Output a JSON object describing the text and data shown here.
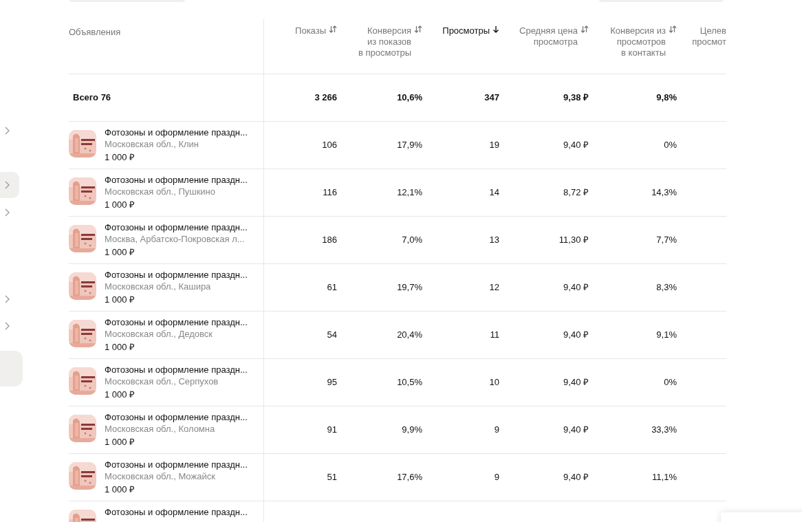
{
  "table": {
    "columns": [
      {
        "label": "Объявления"
      },
      {
        "label": "Показы",
        "selected": false
      },
      {
        "label": "Конверсия\nиз показов\nв просмотры",
        "selected": false
      },
      {
        "label": "Просмотры",
        "selected": true
      },
      {
        "label": "Средняя цена\nпросмотра",
        "selected": false
      },
      {
        "label": "Конверсия из\nпросмотров\nв контакты",
        "selected": false
      },
      {
        "label": "Целев\nпросмот"
      }
    ],
    "total": {
      "label": "Всего 76",
      "values": [
        "3 266",
        "10,6%",
        "347",
        "9,38 ₽",
        "9,8%"
      ]
    },
    "rows": [
      {
        "title": "Фотозоны и оформление праздн...",
        "location": "Московская обл., Клин",
        "price": "1 000 ₽",
        "values": [
          "106",
          "17,9%",
          "19",
          "9,40 ₽",
          "0%"
        ]
      },
      {
        "title": "Фотозоны и оформление праздн...",
        "location": "Московская обл., Пушкино",
        "price": "1 000 ₽",
        "values": [
          "116",
          "12,1%",
          "14",
          "8,72 ₽",
          "14,3%"
        ]
      },
      {
        "title": "Фотозоны и оформление праздн...",
        "location": "Москва, Арбатско-Покровская л...",
        "price": "1 000 ₽",
        "values": [
          "186",
          "7,0%",
          "13",
          "11,30 ₽",
          "7,7%"
        ]
      },
      {
        "title": "Фотозоны и оформление праздн...",
        "location": "Московская обл., Кашира",
        "price": "1 000 ₽",
        "values": [
          "61",
          "19,7%",
          "12",
          "9,40 ₽",
          "8,3%"
        ]
      },
      {
        "title": "Фотозоны и оформление праздн...",
        "location": "Московская обл., Дедовск",
        "price": "1 000 ₽",
        "values": [
          "54",
          "20,4%",
          "11",
          "9,40 ₽",
          "9,1%"
        ]
      },
      {
        "title": "Фотозоны и оформление праздн...",
        "location": "Московская обл., Серпухов",
        "price": "1 000 ₽",
        "values": [
          "95",
          "10,5%",
          "10",
          "9,40 ₽",
          "0%"
        ]
      },
      {
        "title": "Фотозоны и оформление праздн...",
        "location": "Московская обл., Коломна",
        "price": "1 000 ₽",
        "values": [
          "91",
          "9,9%",
          "9",
          "9,40 ₽",
          "33,3%"
        ]
      },
      {
        "title": "Фотозоны и оформление праздн...",
        "location": "Московская обл., Можайск",
        "price": "1 000 ₽",
        "values": [
          "51",
          "17,6%",
          "9",
          "9,40 ₽",
          "11,1%"
        ]
      },
      {
        "title": "Фотозоны и оформление праздн..."
      }
    ]
  }
}
